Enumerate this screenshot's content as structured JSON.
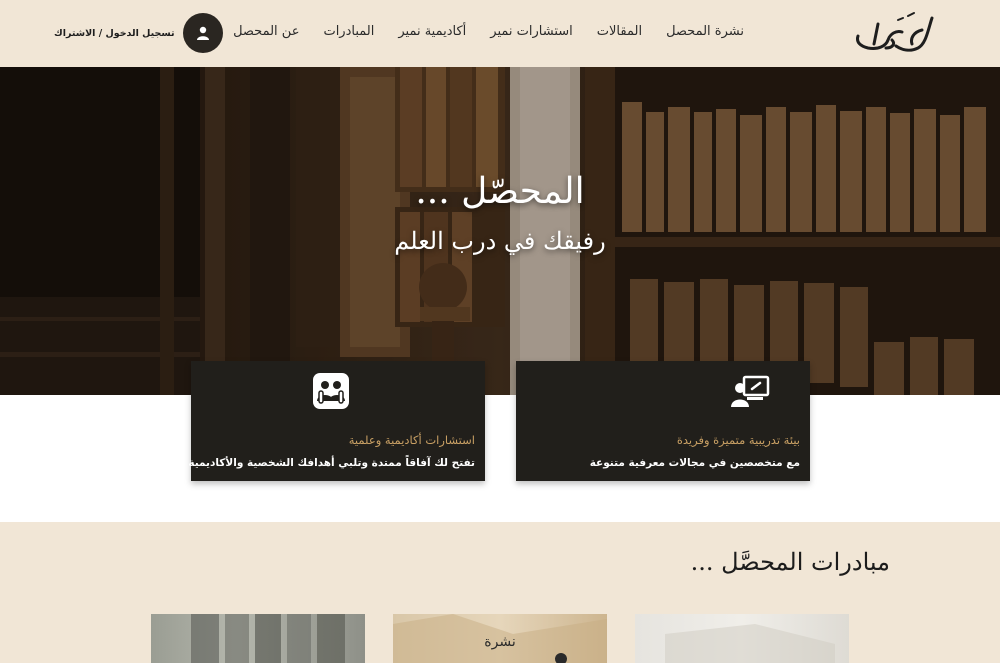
{
  "brand": {
    "logo_text": "المحصّل"
  },
  "nav": {
    "items": [
      "عن المحصل",
      "المبادرات",
      "أكاديمية نمير",
      "استشارات نمير",
      "المقالات",
      "نشرة المحصل"
    ]
  },
  "login": {
    "label": "تسجيل الدخول / الاشتراك"
  },
  "hero": {
    "title": "المحصّل ...",
    "subtitle": "رفيقك في درب العلم"
  },
  "cards": [
    {
      "icon": "presentation-icon",
      "title": "بيئة تدريبية متميزة وفريدة",
      "desc": "مع متخصصين في مجالات معرفية متنوعة"
    },
    {
      "icon": "consultation-icon",
      "title": "استشارات أكاديمية وعلمية",
      "desc": "تفتح لك آفاقاً ممتدة وتلبي أهدافك الشخصية والأكاديمية"
    }
  ],
  "section": {
    "title": "مبادرات المحصَّل ..."
  },
  "thumbs": [
    {
      "label": ""
    },
    {
      "label": "نشرة"
    },
    {
      "label": ""
    }
  ],
  "colors": {
    "accent": "#c9a064",
    "dark": "#211f1b",
    "beige": "#f1e6d6"
  }
}
